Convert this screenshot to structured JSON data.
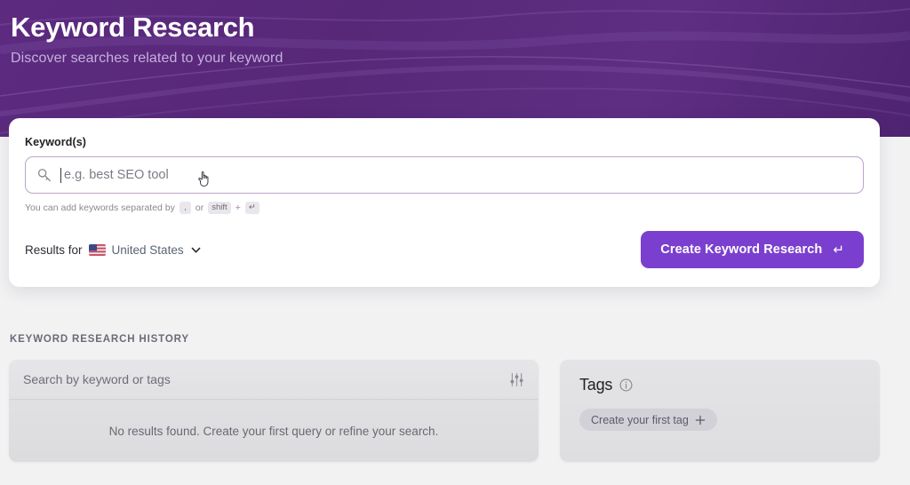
{
  "hero": {
    "title": "Keyword Research",
    "subtitle": "Discover searches related to your keyword",
    "bg_color": "#5c2b80",
    "subtitle_color": "#c6b0dd"
  },
  "search_card": {
    "keyword_label": "Keyword(s)",
    "keyword_input": {
      "value": "",
      "placeholder": "e.g. best SEO tool",
      "icon": "key-icon",
      "focused": true
    },
    "helper": {
      "prefix": "You can add keywords separated by",
      "key_comma": ",",
      "conjunction": "or",
      "key_shift": "shift",
      "plus": "+",
      "key_enter": "↵"
    },
    "results_for": {
      "label": "Results for",
      "country": "United States",
      "flag": "us-flag-icon",
      "chevron": "chevron-down-icon"
    },
    "create_button": {
      "label": "Create Keyword Research",
      "enter_glyph": "↵",
      "color": "#7b3fcf"
    }
  },
  "history": {
    "section_title": "KEYWORD RESEARCH HISTORY",
    "search_placeholder": "Search by keyword or tags",
    "search_value": "",
    "filter_icon": "sliders-filter-icon",
    "empty_state": "No results found. Create your first query or refine your search."
  },
  "tags": {
    "title": "Tags",
    "info_icon": "info-circle-icon",
    "create_chip_label": "Create your first tag",
    "plus_icon": "plus-icon"
  }
}
